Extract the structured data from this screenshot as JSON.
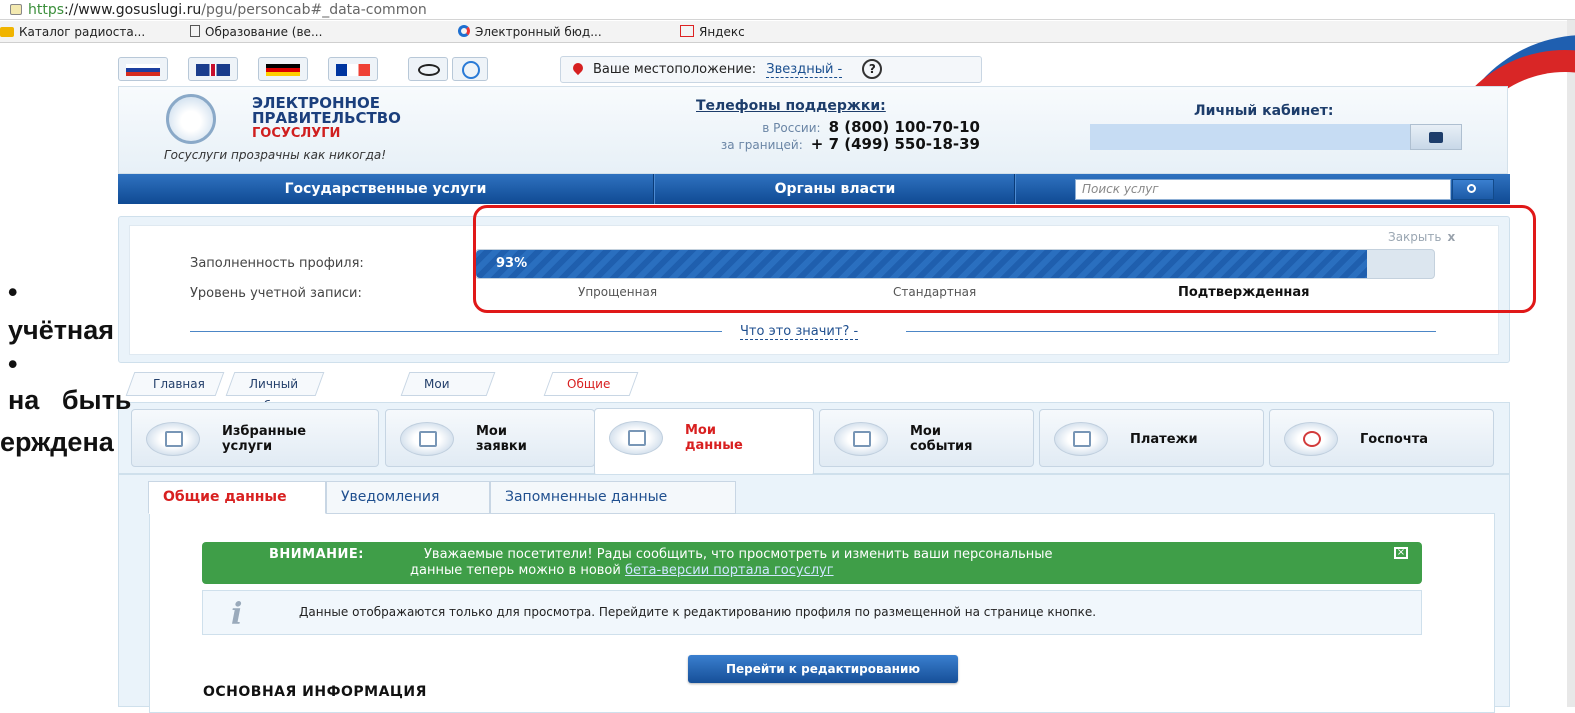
{
  "browser": {
    "url_scheme": "https",
    "url_host": "://www.gosuslugi.ru",
    "url_path": "/pgu/personcab#_data-common",
    "bookmarks": [
      "Каталог радиоста...",
      "Образование (ве...",
      "Электронный бюд...",
      "Яндекс"
    ]
  },
  "overlay_text": [
    "•",
    "учётная",
    "•",
    "на   быть",
    "ерждена"
  ],
  "location": {
    "label": "Ваше местоположение:",
    "city": "Звездный -",
    "help": "?"
  },
  "logo": {
    "line1": "ЭЛЕКТРОННОЕ",
    "line2": "ПРАВИТЕЛЬСТВО",
    "line3": "ГОСУСЛУГИ",
    "slogan": "Госуслуги прозрачны как никогда!"
  },
  "phones": {
    "title": "Телефоны поддержки:",
    "russia_label": "в России:",
    "russia_number": "8 (800) 100-70-10",
    "abroad_label": "за границей:",
    "abroad_number": "+ 7 (499) 550-18-39"
  },
  "cabinet": {
    "title": "Личный кабинет:"
  },
  "nav": {
    "items": [
      "Государственные услуги",
      "Органы власти"
    ],
    "search_placeholder": "Поиск услуг"
  },
  "profile": {
    "close": "Закрыть",
    "close_x": "x",
    "fill_label": "Заполненность профиля:",
    "fill_percent_text": "93%",
    "fill_value": 0.93,
    "level_label": "Уровень учетной записи:",
    "levels": [
      "Упрощенная",
      "Стандартная",
      "Подтвержденная"
    ],
    "what": "Что это значит? -"
  },
  "breadcrumbs": [
    "Главная",
    "Личный кабинет",
    "Мои данные",
    "Общие данные"
  ],
  "big_tabs": [
    {
      "label": "Избранные\nуслуги",
      "icon": "favorites-icon"
    },
    {
      "label": "Мои\nзаявки",
      "icon": "applications-icon"
    },
    {
      "label": "Мои\nданные",
      "icon": "my-data-icon"
    },
    {
      "label": "Мои\nсобытия",
      "icon": "calendar-icon"
    },
    {
      "label": "Платежи",
      "icon": "payments-icon"
    },
    {
      "label": "Госпочта",
      "icon": "mail-icon"
    }
  ],
  "sub_tabs": [
    "Общие данные",
    "Уведомления",
    "Запомненные данные"
  ],
  "alert": {
    "bold": "ВНИМАНИЕ:",
    "line1": "Уважаемые посетители! Рады сообщить, что просмотреть и изменить ваши персональные",
    "line2_prefix": "данные теперь можно в новой ",
    "link": "бета-версии портала госуслуг"
  },
  "info": {
    "icon": "i",
    "text": "Данные отображаются только для просмотра. Перейдите к редактированию профиля по размещенной на странице кнопке."
  },
  "edit_button": "Перейти к редактированию",
  "section_title": "ОСНОВНАЯ ИНФОРМАЦИЯ",
  "colors": {
    "accent": "#1f5fae",
    "alert": "#3f9e48",
    "highlight": "#e01818",
    "active_tab": "#d82020"
  }
}
